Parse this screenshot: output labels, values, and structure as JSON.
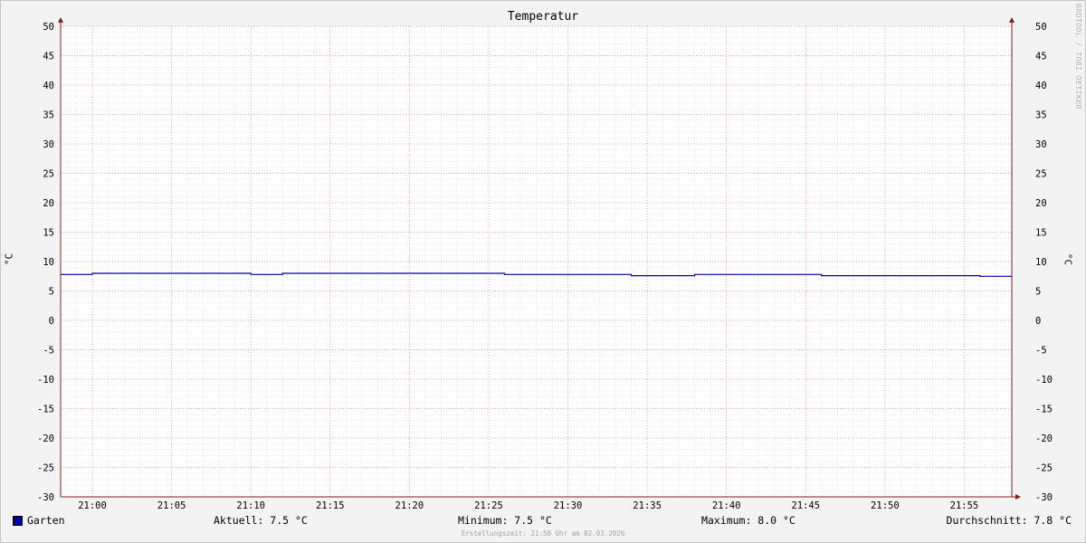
{
  "chart_data": {
    "type": "line",
    "title": "Temperatur",
    "ylabel": "°C",
    "ylim": [
      -30,
      50
    ],
    "ytick_step": 5,
    "yticks": [
      "50",
      "45",
      "40",
      "35",
      "30",
      "25",
      "20",
      "15",
      "10",
      "5",
      "0",
      "-5",
      "-10",
      "-15",
      "-20",
      "-25",
      "-30"
    ],
    "xrange_minutes": [
      "20:58",
      "21:58"
    ],
    "xticks": [
      "21:00",
      "21:05",
      "21:10",
      "21:15",
      "21:20",
      "21:25",
      "21:30",
      "21:35",
      "21:40",
      "21:45",
      "21:50",
      "21:55"
    ],
    "grid": true,
    "legend_position": "bottom-left",
    "series": [
      {
        "name": "Garten",
        "color": "#0000a0",
        "points": [
          [
            "20:58",
            7.8
          ],
          [
            "21:00",
            7.8
          ],
          [
            "21:00",
            8.0
          ],
          [
            "21:10",
            8.0
          ],
          [
            "21:10",
            7.8
          ],
          [
            "21:12",
            7.8
          ],
          [
            "21:12",
            8.0
          ],
          [
            "21:26",
            8.0
          ],
          [
            "21:26",
            7.8
          ],
          [
            "21:34",
            7.8
          ],
          [
            "21:34",
            7.6
          ],
          [
            "21:38",
            7.6
          ],
          [
            "21:38",
            7.8
          ],
          [
            "21:46",
            7.8
          ],
          [
            "21:46",
            7.6
          ],
          [
            "21:56",
            7.6
          ],
          [
            "21:56",
            7.5
          ],
          [
            "21:58",
            7.5
          ]
        ]
      }
    ]
  },
  "legend": {
    "series_name": "Garten",
    "series_color": "#0000a0",
    "aktuell": "Aktuell: 7.5 °C",
    "minimum": "Minimum: 7.5 °C",
    "maximum": "Maximum: 8.0 °C",
    "durchschnitt": "Durchschnitt: 7.8 °C"
  },
  "watermark": "RRDTOOL / TOBI OETIKER",
  "footer": "Erstellungszeit: 21:58 Uhr am 02.03.2026",
  "colors": {
    "background": "#f3f3f3",
    "canvas": "#ffffff",
    "major_grid": "#e08080",
    "minor_grid": "#c8c8c8",
    "axis": "#802020"
  }
}
